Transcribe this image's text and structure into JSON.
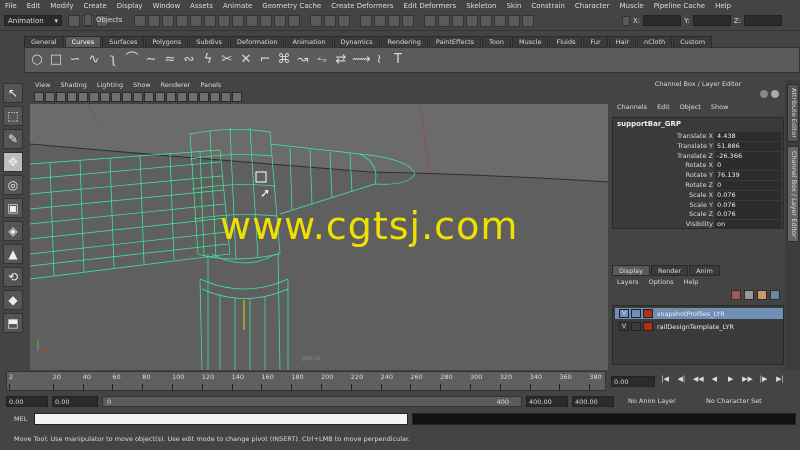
{
  "menubar": [
    "File",
    "Edit",
    "Modify",
    "Create",
    "Display",
    "Window",
    "Assets",
    "Animate",
    "Geometry Cache",
    "Create Deformers",
    "Edit Deformers",
    "Skeleton",
    "Skin",
    "Constrain",
    "Character",
    "Muscle",
    "Pipeline Cache",
    "Help"
  ],
  "status": {
    "mode_menu": "Animation",
    "objects_label": "Objects",
    "x_label": "X:",
    "y_label": "Y:",
    "z_label": "Z:"
  },
  "shelf_tabs": [
    "General",
    "Curves",
    "Surfaces",
    "Polygons",
    "Subdivs",
    "Deformation",
    "Animation",
    "Dynamics",
    "Rendering",
    "PaintEffects",
    "Toon",
    "Muscle",
    "Fluids",
    "Fur",
    "Hair",
    "nCloth",
    "Custom"
  ],
  "shelf_active": "Curves",
  "viewport": {
    "menu": [
      "View",
      "Shading",
      "Lighting",
      "Show",
      "Renderer",
      "Panels"
    ],
    "watermark": "www.cgtsj.com",
    "camera": "persp"
  },
  "channel_box": {
    "title": "Channel Box / Layer Editor",
    "menu": [
      "Channels",
      "Edit",
      "Object",
      "Show"
    ],
    "object_name": "supportBar_GRP",
    "attributes": [
      {
        "label": "Translate X",
        "value": "4.438"
      },
      {
        "label": "Translate Y",
        "value": "51.886"
      },
      {
        "label": "Translate Z",
        "value": "-26.366"
      },
      {
        "label": "Rotate X",
        "value": "0"
      },
      {
        "label": "Rotate Y",
        "value": "76.139"
      },
      {
        "label": "Rotate Z",
        "value": "0"
      },
      {
        "label": "Scale X",
        "value": "0.076"
      },
      {
        "label": "Scale Y",
        "value": "0.076"
      },
      {
        "label": "Scale Z",
        "value": "0.076"
      },
      {
        "label": "Visibility",
        "value": "on"
      }
    ]
  },
  "side_tabs": {
    "attribute_editor": "Attribute Editor",
    "channel_box": "Channel Box / Layer Editor"
  },
  "layer_editor": {
    "tabs": [
      "Display",
      "Render",
      "Anim"
    ],
    "menu": [
      "Layers",
      "Options",
      "Help"
    ],
    "layers": [
      {
        "v": "V",
        "name": "snapshotProfiles_LYR",
        "color": "#b03014",
        "selected": true
      },
      {
        "v": "V",
        "name": "railDesignTemplate_LYR",
        "color": "#b03014",
        "selected": false
      }
    ]
  },
  "time_slider": {
    "ticks": [
      "2",
      "20",
      "40",
      "60",
      "80",
      "100",
      "120",
      "140",
      "160",
      "180",
      "200",
      "220",
      "240",
      "260",
      "280",
      "300",
      "320",
      "340",
      "360",
      "380"
    ],
    "current_time": "0.00"
  },
  "range": {
    "start_time": "0.00",
    "playback_start": "0.00",
    "slider_start": "0",
    "slider_end": "400",
    "playback_end": "400.00",
    "end_time": "400.00",
    "anim_layer": "No Anim Layer",
    "character_set": "No Character Set"
  },
  "command_line": {
    "label": "MEL"
  },
  "help_line": "Move Tool: Use manipulator to move object(s). Use edit mode to change pivot (INSERT). Ctrl+LMB to move perpendicular.",
  "colors": {
    "wireframe": "#3cf0a0",
    "watermark": "#f0e000",
    "layer_selected": "#6f8fb4"
  }
}
